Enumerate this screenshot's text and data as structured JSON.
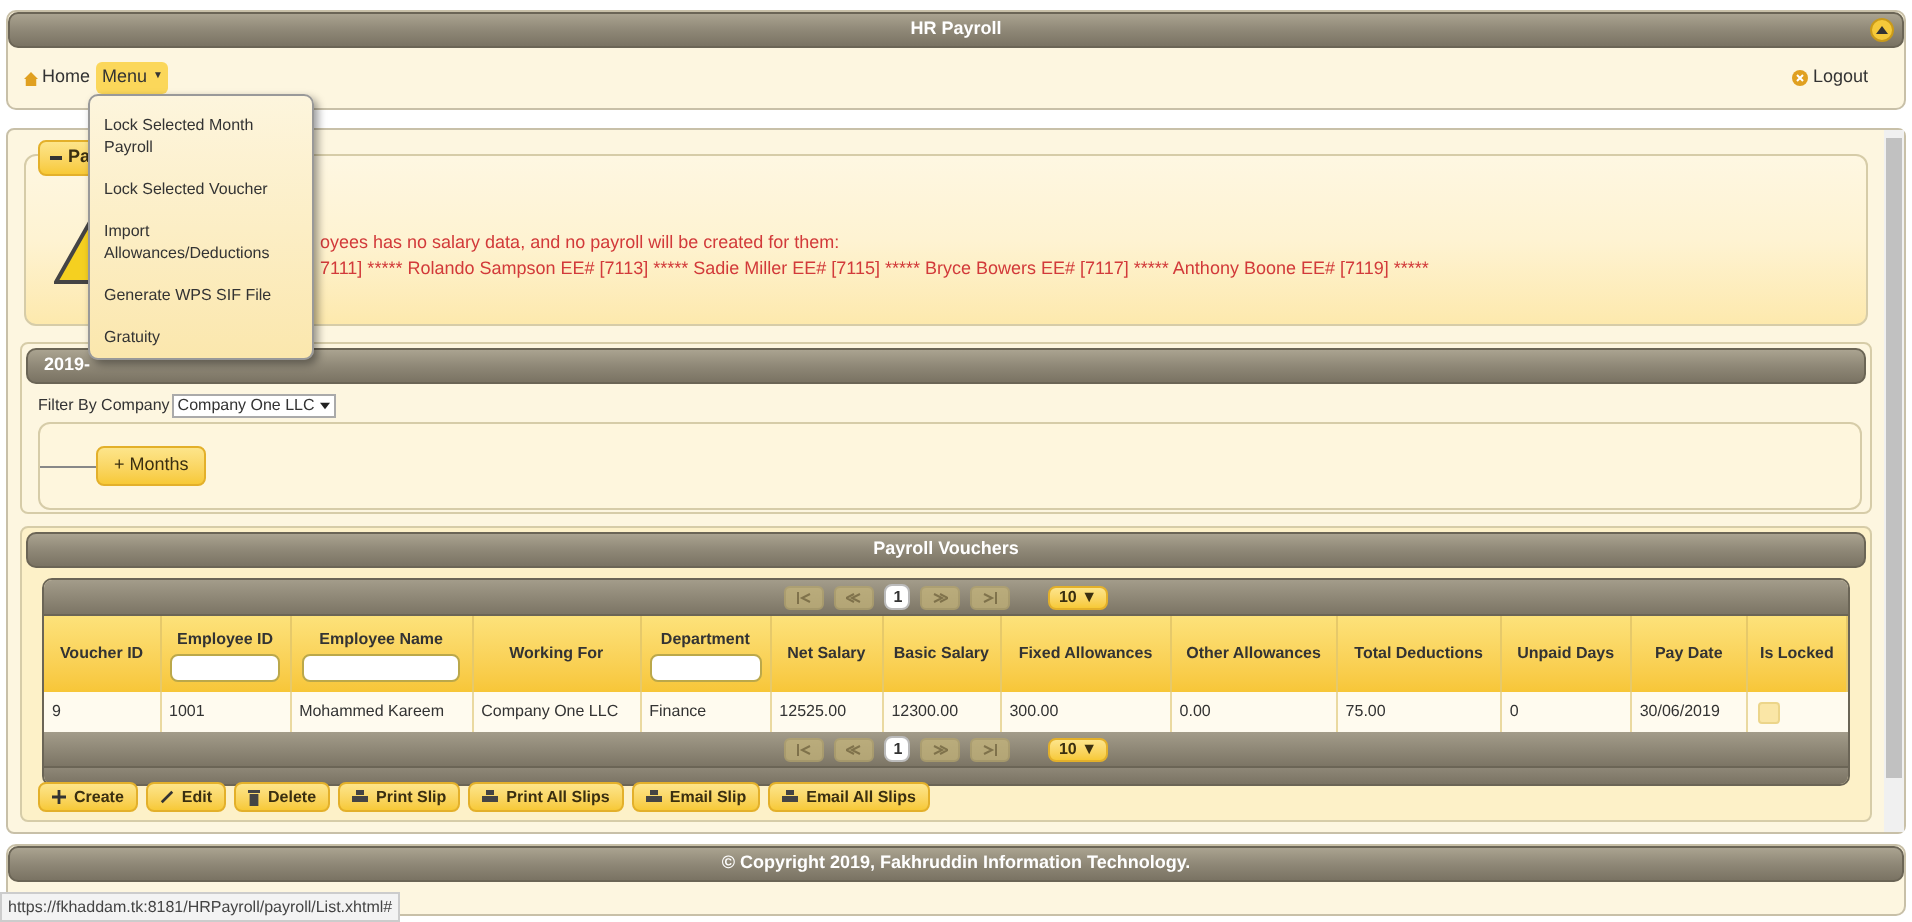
{
  "header": {
    "title": "HR Payroll"
  },
  "nav": {
    "home": "Home",
    "menu": "Menu",
    "menu_caret": "▼",
    "logout": "Logout"
  },
  "menu_dropdown": {
    "items": [
      {
        "label": "Lock Selected Month Payroll"
      },
      {
        "label": "Lock Selected Voucher"
      },
      {
        "label": "Import Allowances/Deductions"
      },
      {
        "label": "Generate WPS SIF File"
      },
      {
        "label": "Gratuity"
      }
    ]
  },
  "messages": {
    "legend": "Pa",
    "lines": [
      "oyees has no salary data, and no payroll will be created for them:",
      "7111] ***** Rolando Sampson EE# [7113] ***** Sadie Miller EE# [7115] ***** Bryce Bowers EE# [7117] ***** Anthony Boone EE# [7119] *****"
    ]
  },
  "month_panel": {
    "title": "2019-",
    "filter_label": "Filter By Company",
    "company": "Company One LLC",
    "months_button": "+ Months"
  },
  "vouchers": {
    "title": "Payroll Vouchers",
    "pager": {
      "page": "1",
      "page_size": "10 ▼"
    },
    "columns": [
      {
        "label": "Voucher ID",
        "filter": false
      },
      {
        "label": "Employee ID",
        "filter": true
      },
      {
        "label": "Employee Name",
        "filter": true
      },
      {
        "label": "Working For",
        "filter": false
      },
      {
        "label": "Department",
        "filter": true
      },
      {
        "label": "Net Salary",
        "filter": false
      },
      {
        "label": "Basic Salary",
        "filter": false
      },
      {
        "label": "Fixed Allowances",
        "filter": false
      },
      {
        "label": "Other Allowances",
        "filter": false
      },
      {
        "label": "Total Deductions",
        "filter": false
      },
      {
        "label": "Unpaid Days",
        "filter": false
      },
      {
        "label": "Pay Date",
        "filter": false
      },
      {
        "label": "Is Locked",
        "filter": false
      }
    ],
    "rows": [
      {
        "cells": [
          "9",
          "1001",
          "Mohammed Kareem",
          "Company One LLC",
          "Finance",
          "12525.00",
          "12300.00",
          "300.00",
          "0.00",
          "75.00",
          "0",
          "30/06/2019"
        ],
        "locked": false
      }
    ],
    "bottom_pager": {
      "page": "1",
      "page_size": "10 ▼"
    },
    "buttons": [
      {
        "label": "Create",
        "kind": "create"
      },
      {
        "label": "Edit",
        "kind": "edit"
      },
      {
        "label": "Delete",
        "kind": "delete"
      },
      {
        "label": "Print Slip",
        "kind": "print"
      },
      {
        "label": "Print All Slips",
        "kind": "print"
      },
      {
        "label": "Email Slip",
        "kind": "print"
      },
      {
        "label": "Email All Slips",
        "kind": "print"
      }
    ]
  },
  "footer": {
    "text": "© Copyright 2019, Fakhruddin Information Technology."
  },
  "status_url": "https://fkhaddam.tk:8181/HRPayroll/payroll/List.xhtml#"
}
